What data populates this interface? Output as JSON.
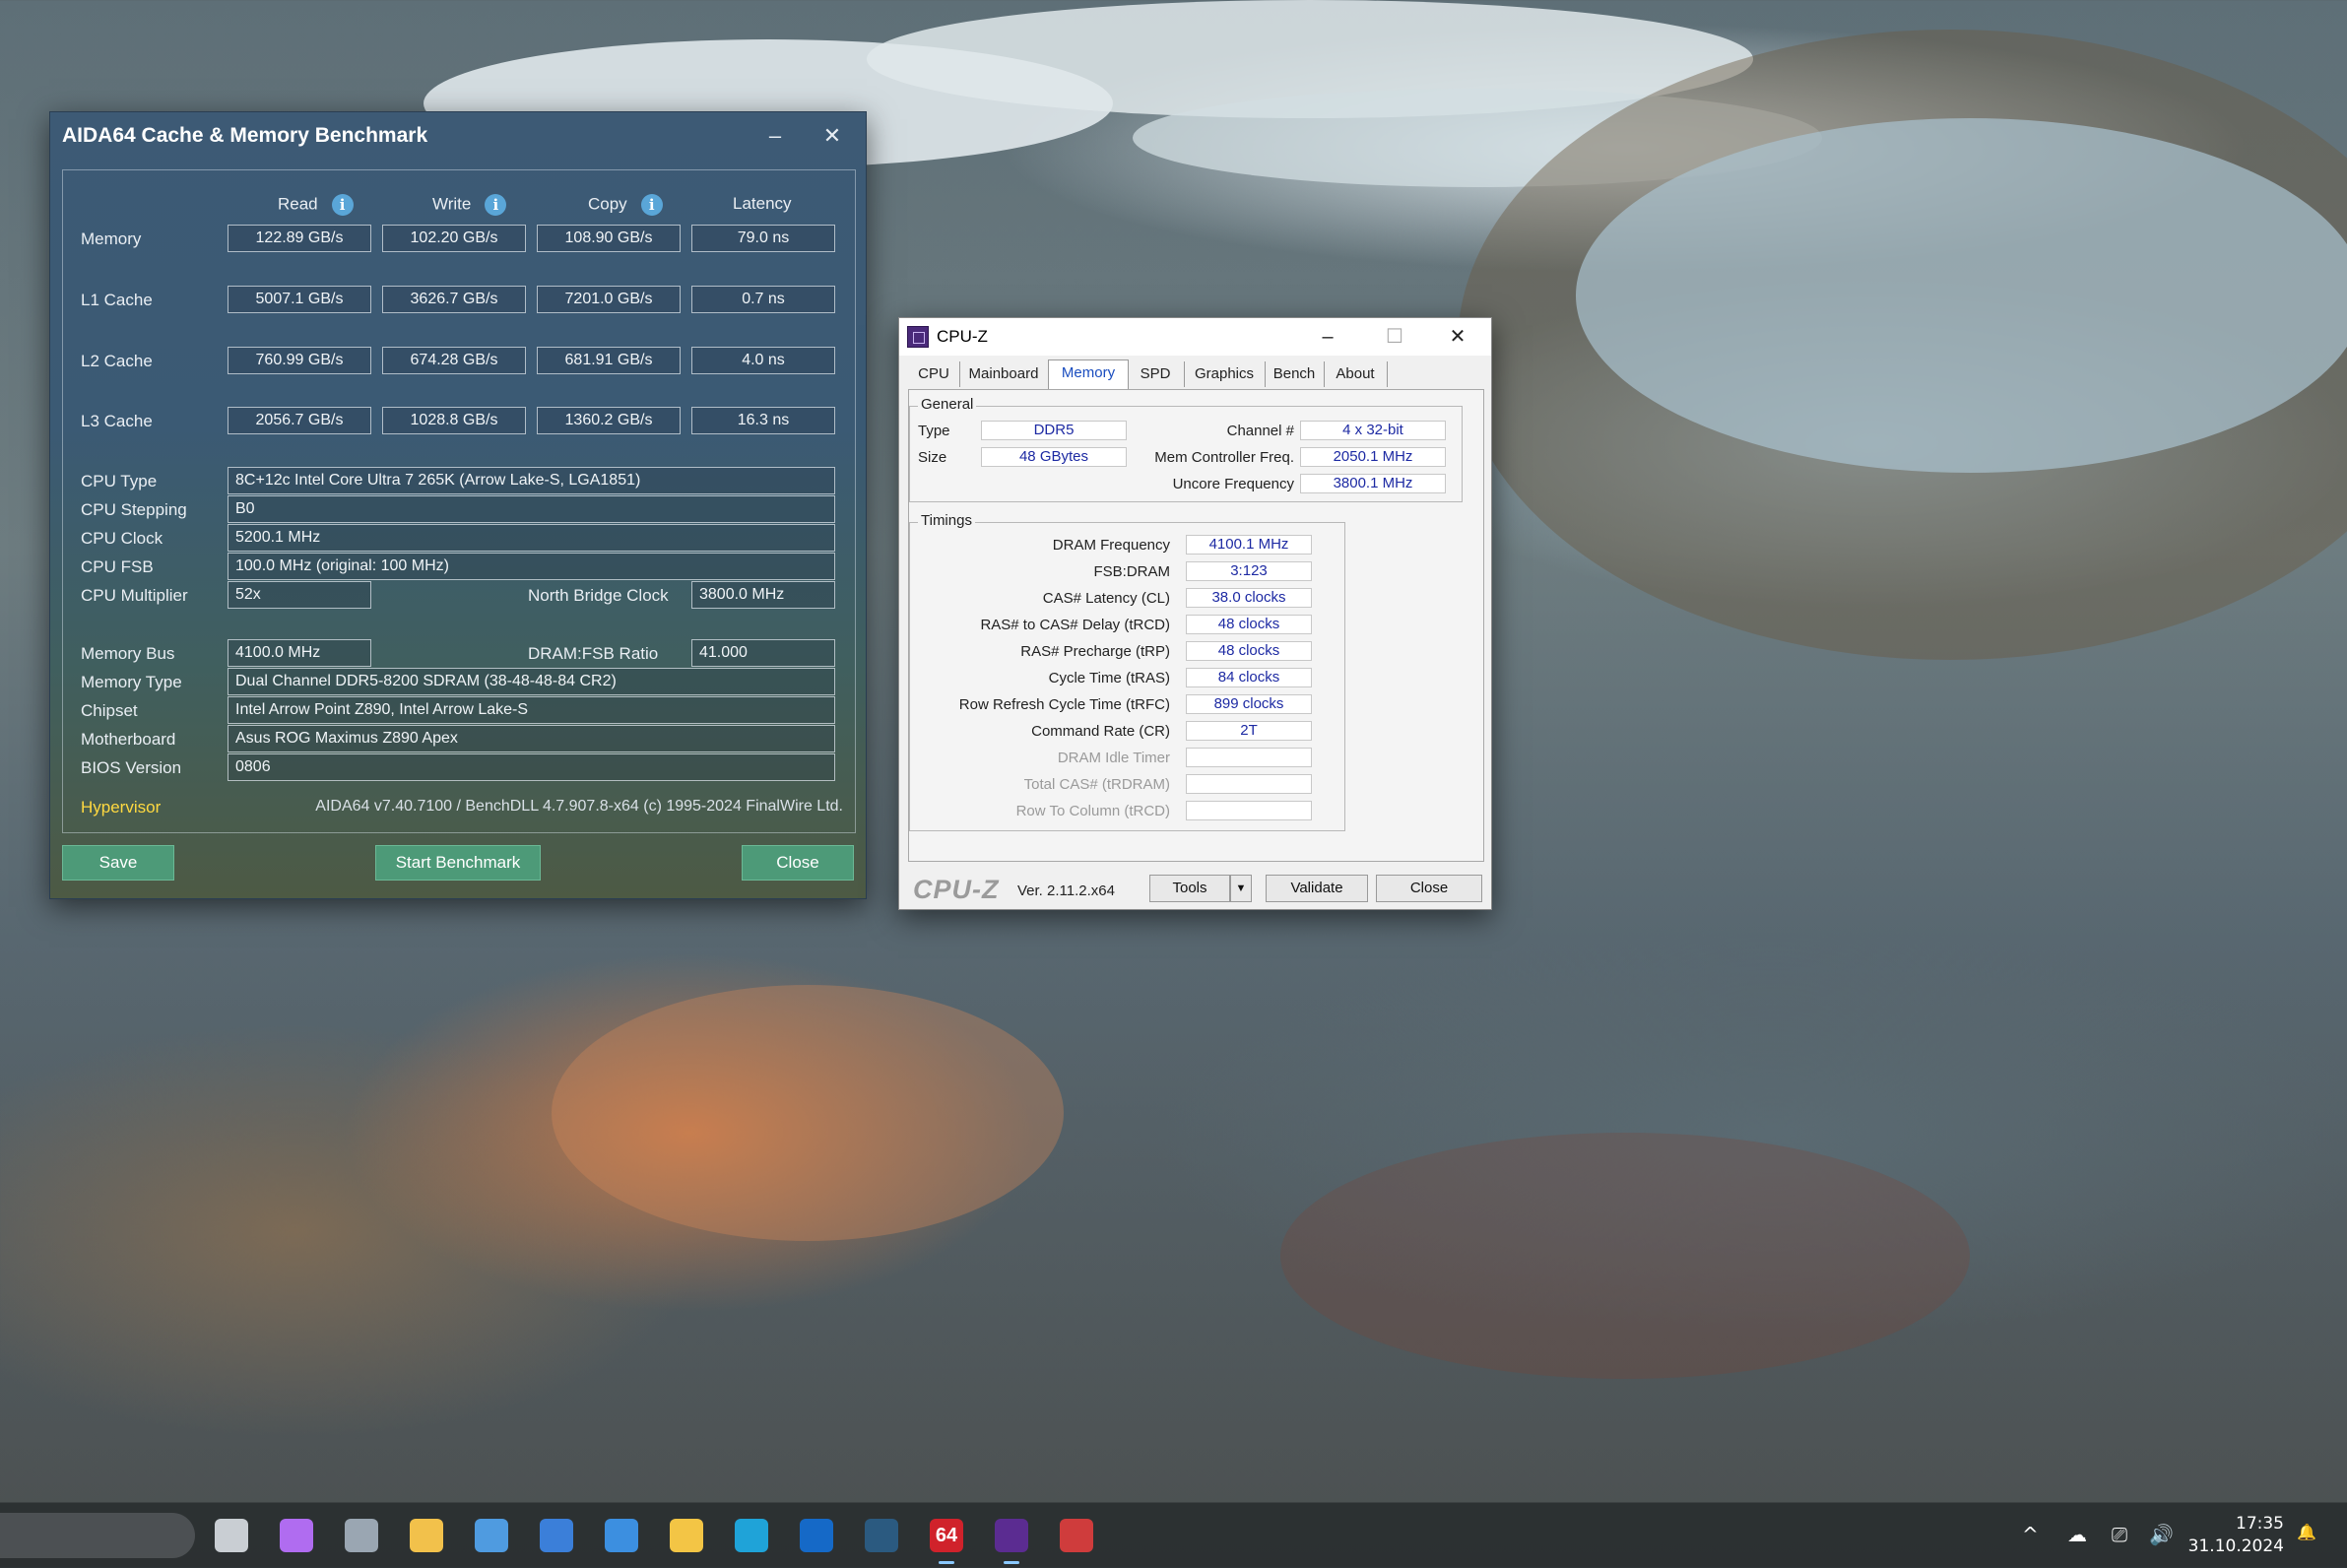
{
  "aida": {
    "title": "AIDA64 Cache & Memory Benchmark",
    "columns": [
      "Read",
      "Write",
      "Copy",
      "Latency"
    ],
    "info_glyph": "i",
    "rows": [
      {
        "label": "Memory",
        "values": [
          "122.89 GB/s",
          "102.20 GB/s",
          "108.90 GB/s",
          "79.0 ns"
        ]
      },
      {
        "label": "L1 Cache",
        "values": [
          "5007.1 GB/s",
          "3626.7 GB/s",
          "7201.0 GB/s",
          "0.7 ns"
        ]
      },
      {
        "label": "L2 Cache",
        "values": [
          "760.99 GB/s",
          "674.28 GB/s",
          "681.91 GB/s",
          "4.0 ns"
        ]
      },
      {
        "label": "L3 Cache",
        "values": [
          "2056.7 GB/s",
          "1028.8 GB/s",
          "1360.2 GB/s",
          "16.3 ns"
        ]
      }
    ],
    "cpu_type_label": "CPU Type",
    "cpu_type": "8C+12c Intel Core Ultra 7 265K  (Arrow Lake-S, LGA1851)",
    "cpu_stepping_label": "CPU Stepping",
    "cpu_stepping": "B0",
    "cpu_clock_label": "CPU Clock",
    "cpu_clock": "5200.1 MHz",
    "cpu_fsb_label": "CPU FSB",
    "cpu_fsb": "100.0 MHz  (original: 100 MHz)",
    "cpu_mult_label": "CPU Multiplier",
    "cpu_mult": "52x",
    "nb_clock_label": "North Bridge Clock",
    "nb_clock": "3800.0 MHz",
    "mem_bus_label": "Memory Bus",
    "mem_bus": "4100.0 MHz",
    "dram_fsb_label": "DRAM:FSB Ratio",
    "dram_fsb": "41.000",
    "mem_type_label": "Memory Type",
    "mem_type": "Dual Channel DDR5-8200 SDRAM  (38-48-48-84 CR2)",
    "chipset_label": "Chipset",
    "chipset": "Intel Arrow Point Z890, Intel Arrow Lake-S",
    "mobo_label": "Motherboard",
    "mobo": "Asus ROG Maximus Z890 Apex",
    "bios_label": "BIOS Version",
    "bios": "0806",
    "hypervisor": "Hypervisor",
    "copyright": "AIDA64 v7.40.7100 / BenchDLL 4.7.907.8-x64  (c) 1995-2024 FinalWire Ltd.",
    "btn_save": "Save",
    "btn_start": "Start Benchmark",
    "btn_close": "Close",
    "minimize_glyph": "–",
    "close_glyph": "✕"
  },
  "cpuz": {
    "title": "CPU-Z",
    "tabs": [
      "CPU",
      "Mainboard",
      "Memory",
      "SPD",
      "Graphics",
      "Bench",
      "About"
    ],
    "active_tab": "Memory",
    "general_title": "General",
    "type_label": "Type",
    "type": "DDR5",
    "size_label": "Size",
    "size": "48 GBytes",
    "channel_label": "Channel #",
    "channel": "4 x 32-bit",
    "mcf_label": "Mem Controller Freq.",
    "mcf": "2050.1 MHz",
    "uncore_label": "Uncore Frequency",
    "uncore": "3800.1 MHz",
    "timings_title": "Timings",
    "timings": [
      {
        "label": "DRAM Frequency",
        "value": "4100.1 MHz",
        "dim": false
      },
      {
        "label": "FSB:DRAM",
        "value": "3:123",
        "dim": false
      },
      {
        "label": "CAS# Latency (CL)",
        "value": "38.0 clocks",
        "dim": false
      },
      {
        "label": "RAS# to CAS# Delay (tRCD)",
        "value": "48 clocks",
        "dim": false
      },
      {
        "label": "RAS# Precharge (tRP)",
        "value": "48 clocks",
        "dim": false
      },
      {
        "label": "Cycle Time (tRAS)",
        "value": "84 clocks",
        "dim": false
      },
      {
        "label": "Row Refresh Cycle Time (tRFC)",
        "value": "899 clocks",
        "dim": false
      },
      {
        "label": "Command Rate (CR)",
        "value": "2T",
        "dim": false
      },
      {
        "label": "DRAM Idle Timer",
        "value": "",
        "dim": true
      },
      {
        "label": "Total CAS# (tRDRAM)",
        "value": "",
        "dim": true
      },
      {
        "label": "Row To Column (tRCD)",
        "value": "",
        "dim": true
      }
    ],
    "logo": "CPU-Z",
    "version": "Ver. 2.11.2.x64",
    "btn_tools": "Tools",
    "tools_arrow": "▼",
    "btn_validate": "Validate",
    "btn_close": "Close",
    "minimize_glyph": "–",
    "maximize_glyph": "☐",
    "close_glyph": "✕"
  },
  "taskbar": {
    "icons": [
      {
        "name": "task-view-icon",
        "color": "#c9ced3"
      },
      {
        "name": "copilot-icon",
        "color": "#b06cf0"
      },
      {
        "name": "calculator-icon",
        "color": "#9aa6b2"
      },
      {
        "name": "microsoft-store-icon",
        "color": "#f2c14b"
      },
      {
        "name": "control-panel-icon",
        "color": "#4f9be0"
      },
      {
        "name": "photos-icon",
        "color": "#3b7fd9"
      },
      {
        "name": "task-manager-icon",
        "color": "#3c8fe0"
      },
      {
        "name": "file-explorer-icon",
        "color": "#f3c545"
      },
      {
        "name": "edge-icon",
        "color": "#1fa3d8"
      },
      {
        "name": "outlook-icon",
        "color": "#1569c7"
      },
      {
        "name": "steam-icon",
        "color": "#2b5a80"
      },
      {
        "name": "aida64-icon",
        "color": "#d0222b"
      },
      {
        "name": "cpuz-icon",
        "color": "#5b2c91"
      },
      {
        "name": "device-tool-icon",
        "color": "#cf3c3c"
      }
    ],
    "aida_icon_text": "64",
    "tray_chevron": "^",
    "tray_glyphs": [
      "☁",
      "⎚",
      "🔊"
    ],
    "time": "17:35",
    "date": "31.10.2024"
  }
}
